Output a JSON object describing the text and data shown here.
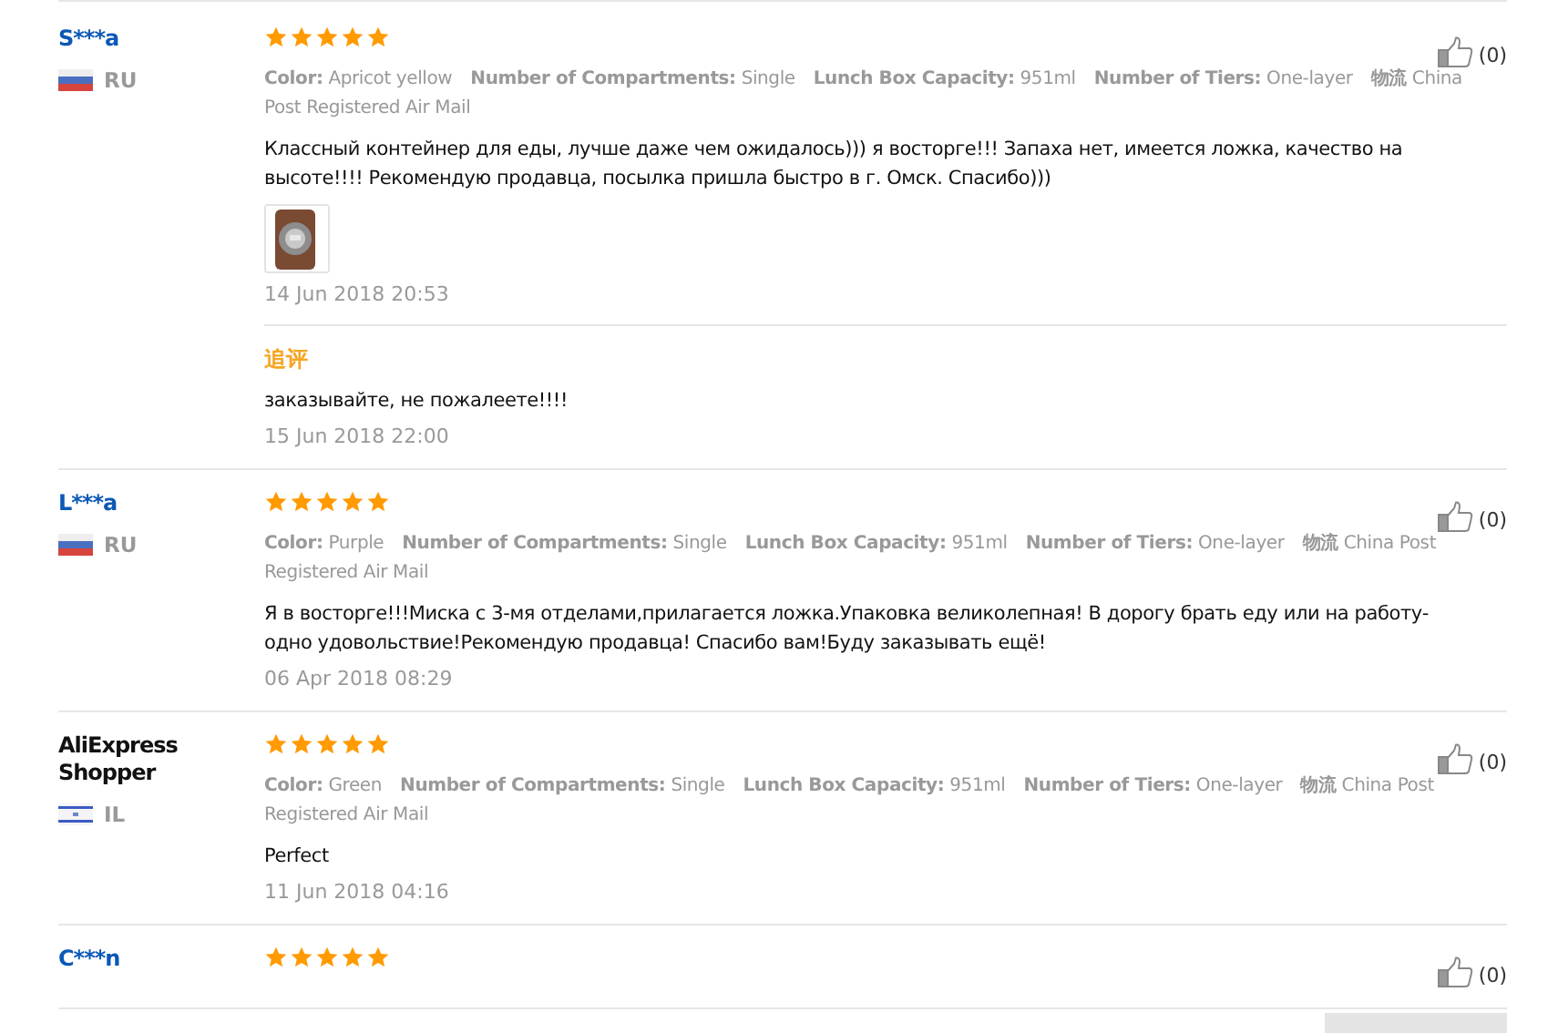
{
  "reviews": [
    {
      "name": "S***a",
      "name_link": true,
      "flag": {
        "kind": "ru"
      },
      "country": "RU",
      "stars": 5,
      "likes": "(0)",
      "attributes": [
        {
          "label": "Color:",
          "value": "Apricot yellow"
        },
        {
          "label": "Number of Compartments:",
          "value": "Single"
        },
        {
          "label": "Lunch Box Capacity:",
          "value": "951ml"
        },
        {
          "label": "Number of Tiers:",
          "value": "One-layer"
        },
        {
          "label": "物流",
          "value": "China Post Registered Air Mail"
        }
      ],
      "text": "Классный контейнер для еды, лучше даже чем ожидалось))) я восторге!!! Запаха нет, имеется ложка, качество на высоте!!!! Рекомендую продавца, посылка пришла быстро в г. Омск. Спасибо)))",
      "images": [
        {
          "kind": "picture"
        }
      ],
      "date": "14 Jun 2018 20:53",
      "followups": [
        {
          "label": "追评",
          "text": "заказывайте, не пожалеете!!!!",
          "date": "15 Jun 2018 22:00"
        }
      ]
    },
    {
      "name": "L***a",
      "name_link": true,
      "flag": {
        "kind": "ru"
      },
      "country": "RU",
      "stars": 5,
      "likes": "(0)",
      "attributes": [
        {
          "label": "Color:",
          "value": "Purple"
        },
        {
          "label": "Number of Compartments:",
          "value": "Single"
        },
        {
          "label": "Lunch Box Capacity:",
          "value": "951ml"
        },
        {
          "label": "Number of Tiers:",
          "value": "One-layer"
        },
        {
          "label": "物流",
          "value": "China Post Registered Air Mail"
        }
      ],
      "text": "Я в восторге!!!Миска с 3-мя отделами,прилагается ложка.Упаковка великолепная! В дорогу брать еду или на работу-одно удовольствие!Рекомендую продавца! Спасибо вам!Буду заказывать ещё!",
      "date": "06 Apr 2018 08:29"
    },
    {
      "name": "AliExpress Shopper",
      "name_link": false,
      "flag": {
        "kind": "il"
      },
      "country": "IL",
      "stars": 5,
      "likes": "(0)",
      "attributes": [
        {
          "label": "Color:",
          "value": "Green"
        },
        {
          "label": "Number of Compartments:",
          "value": "Single"
        },
        {
          "label": "Lunch Box Capacity:",
          "value": "951ml"
        },
        {
          "label": "Number of Tiers:",
          "value": "One-layer"
        },
        {
          "label": "物流",
          "value": "China Post Registered Air Mail"
        }
      ],
      "text": "Perfect",
      "date": "11 Jun 2018 04:16"
    },
    {
      "name": "C***n",
      "name_link": true,
      "stars": 5,
      "likes": "(0)"
    }
  ]
}
